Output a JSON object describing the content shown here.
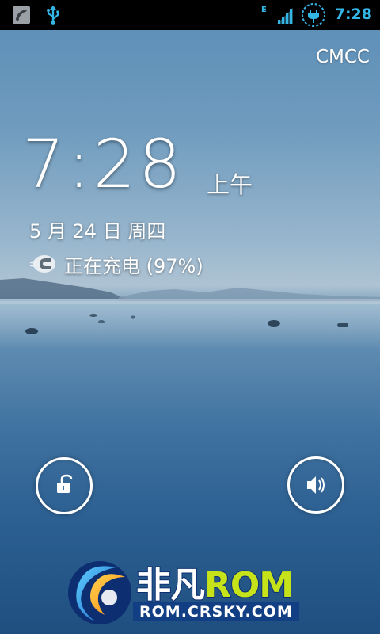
{
  "status_bar": {
    "time": "7:28",
    "network_type": "E",
    "icons": [
      "notification-app-icon",
      "usb-icon",
      "signal-icon",
      "charging-icon"
    ],
    "accent_color": "#33b5e5"
  },
  "lockscreen": {
    "carrier": "CMCC",
    "time": "7:28",
    "ampm": "上午",
    "date": "5 月 24 日 周四",
    "charging_status": "正在充电 (97%)",
    "battery_percent": 97
  },
  "controls": {
    "unlock_icon": "unlock-icon",
    "sound_icon": "speaker-icon"
  },
  "watermark": {
    "title_cn": "非凡",
    "title_en": "ROM",
    "url": "ROM.CRSKY.COM"
  }
}
